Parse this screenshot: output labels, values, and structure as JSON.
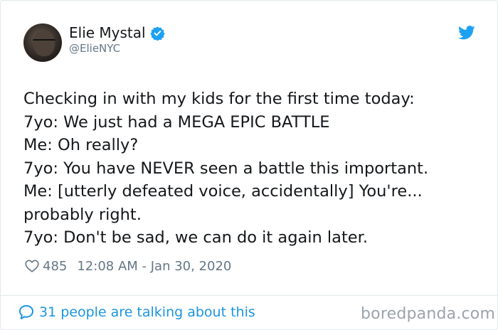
{
  "author": {
    "name": "Elie Mystal",
    "handle": "@ElieNYC"
  },
  "tweet": {
    "lines": [
      "Checking in with my kids for the first time today:",
      "7yo: We just had a MEGA EPIC BATTLE",
      "Me: Oh really?",
      "7yo: You have NEVER seen a battle this important.",
      "Me: [utterly defeated voice, accidentally] You're...",
      "probably right.",
      "7yo: Don't be sad, we can do it again later."
    ],
    "likes": "485",
    "timestamp": "12:08 AM - Jan 30, 2020"
  },
  "footer": {
    "talking": "31 people are talking about this"
  },
  "watermark": "boredpanda.com",
  "colors": {
    "twitter_blue": "#1da1f2",
    "link_blue": "#1b95e0",
    "muted": "#657786"
  },
  "icons": [
    "verified-badge-icon",
    "twitter-bird-icon",
    "heart-icon",
    "speech-bubble-icon"
  ]
}
